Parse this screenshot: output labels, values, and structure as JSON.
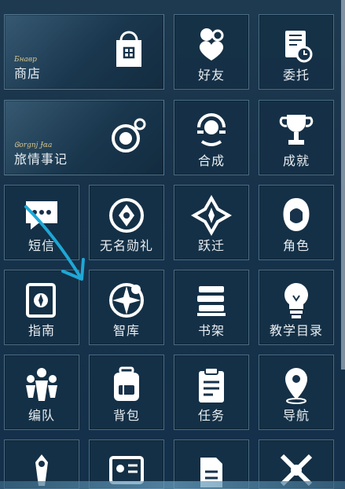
{
  "menu": {
    "items": [
      {
        "label": "商店",
        "icon": "shopping-bag-icon",
        "deco": "Бнавр"
      },
      {
        "label": "好友",
        "icon": "friends-heart-icon"
      },
      {
        "label": "委托",
        "icon": "commission-clipboard-icon"
      },
      {
        "label": "旅情事记",
        "icon": "journey-orb-icon",
        "deco": "Ꮆorgnj Ɉɑa"
      },
      {
        "label": "合成",
        "icon": "synthesis-icon"
      },
      {
        "label": "成就",
        "icon": "trophy-icon"
      },
      {
        "label": "短信",
        "icon": "message-icon"
      },
      {
        "label": "无名勋礼",
        "icon": "medal-icon"
      },
      {
        "label": "跃迁",
        "icon": "warp-icon"
      },
      {
        "label": "角色",
        "icon": "character-icon"
      },
      {
        "label": "指南",
        "icon": "guide-icon"
      },
      {
        "label": "智库",
        "icon": "database-icon"
      },
      {
        "label": "书架",
        "icon": "bookshelf-icon"
      },
      {
        "label": "教学目录",
        "icon": "lightbulb-icon"
      },
      {
        "label": "编队",
        "icon": "team-icon"
      },
      {
        "label": "背包",
        "icon": "backpack-icon"
      },
      {
        "label": "任务",
        "icon": "mission-clipboard-icon"
      },
      {
        "label": "导航",
        "icon": "location-pin-icon"
      }
    ]
  },
  "colors": {
    "arrow": "#1ea7d6",
    "tile_border": "#7aa0b9",
    "text": "#e9eef2"
  }
}
